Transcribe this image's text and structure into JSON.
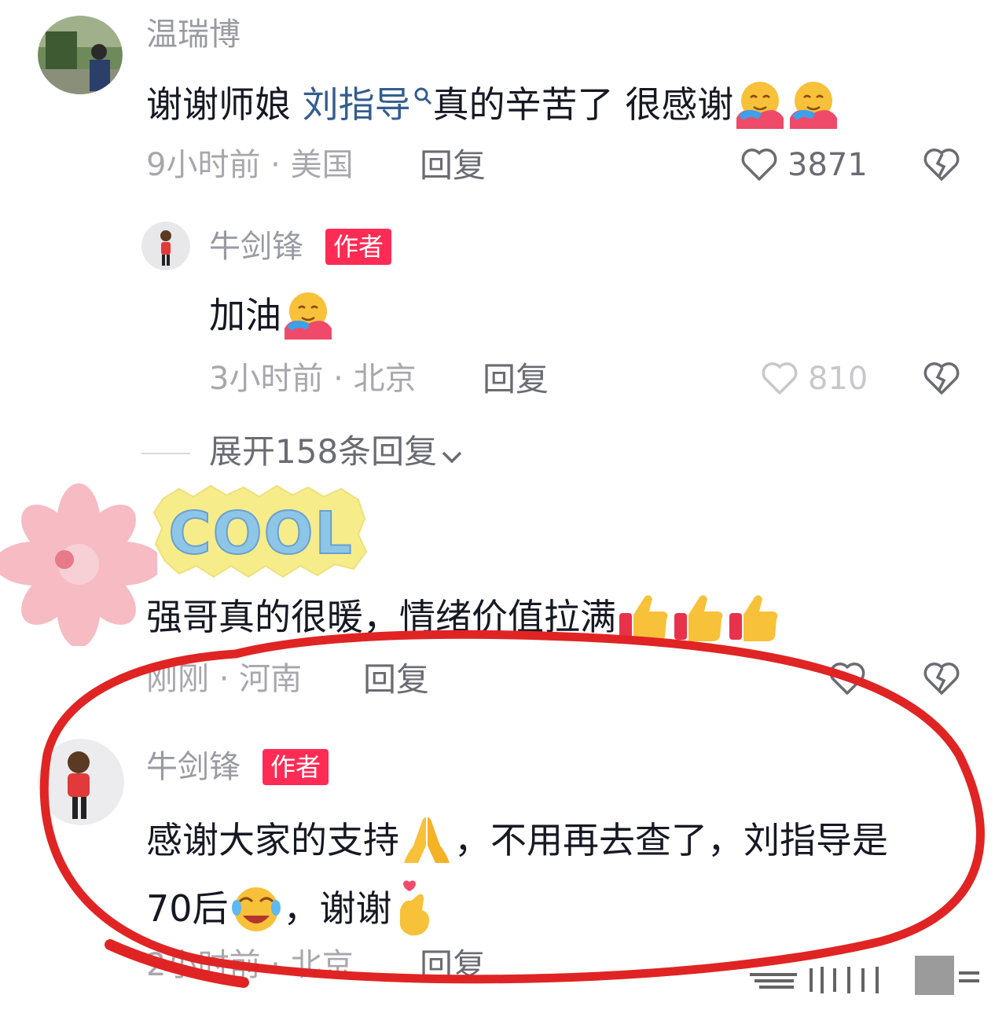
{
  "comments": [
    {
      "username": "温瑞博",
      "text_prefix": "谢谢师娘 ",
      "mention": "刘指导",
      "text_suffix": "真的辛苦了 很感谢",
      "time": "9小时前",
      "location": "美国",
      "reply_label": "回复",
      "likes": "3871"
    },
    {
      "username": "牛剑锋",
      "badge": "作者",
      "text": "加油",
      "time": "3小时前",
      "location": "北京",
      "reply_label": "回复",
      "likes": "810"
    },
    {
      "text": "强哥真的很暖，情绪价值拉满",
      "time": "刚刚",
      "location": "河南",
      "reply_label": "回复",
      "sticker": "COOL"
    },
    {
      "username": "牛剑锋",
      "badge": "作者",
      "text_line1_a": "感谢大家的支持",
      "text_line1_b": "，不用再去查了，刘指导是",
      "text_line2_a": "70后",
      "text_line2_b": "，谢谢",
      "time": "2小时前",
      "location": "北京",
      "reply_label": "回复"
    }
  ],
  "expand": {
    "label": "展开158条回复"
  },
  "colors": {
    "accent": "#fe2c55",
    "annotation": "#e02424",
    "mention": "#345d8f"
  },
  "icons": [
    "heart-icon",
    "dislike-icon",
    "search-icon",
    "chevron-down-icon",
    "hug-emoji",
    "thumbs-up-emoji",
    "pray-emoji",
    "laugh-emoji",
    "finger-heart-emoji"
  ]
}
